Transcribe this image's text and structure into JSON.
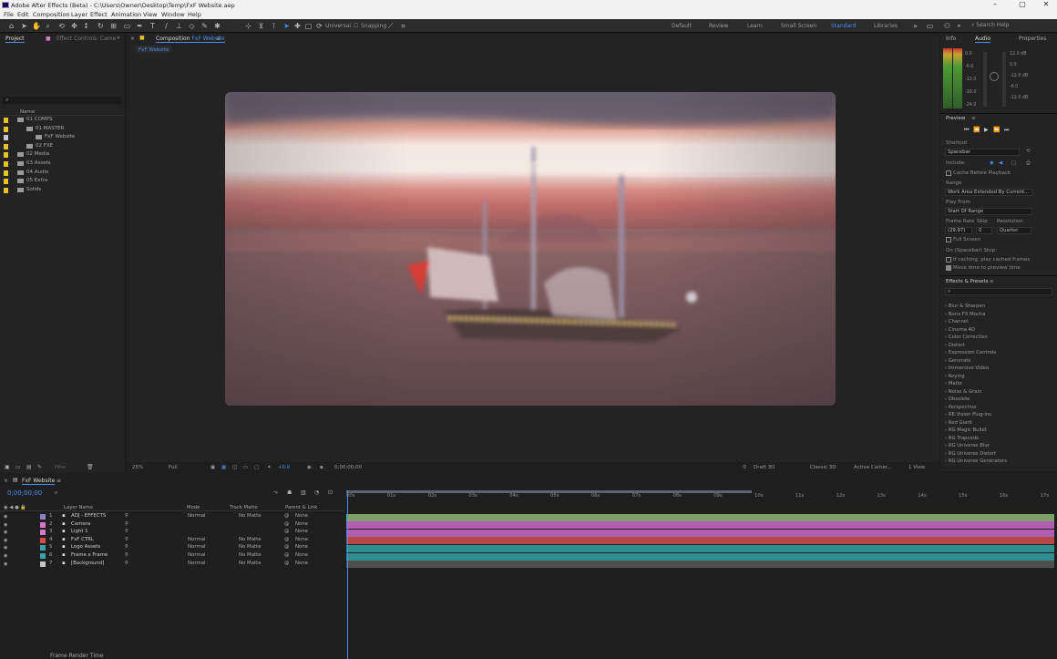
{
  "window": {
    "title": "Adobe After Effects (Beta) - C:\\Users\\Owner\\Desktop\\Temp\\FxF Website.aep"
  },
  "menu": [
    "File",
    "Edit",
    "Composition",
    "Layer",
    "Effect",
    "Animation",
    "View",
    "Window",
    "Help"
  ],
  "toolbar": {
    "universal": "Universal",
    "snapping": "Snapping",
    "workspaces": [
      "Default",
      "Review",
      "Learn",
      "Small Screen",
      "Standard",
      "Libraries"
    ],
    "active_workspace": "Standard",
    "search_placeholder": "Search Help"
  },
  "project": {
    "tabs": [
      "Project",
      "Effect Controls: Came"
    ],
    "col_name": "Name",
    "items": [
      {
        "label": "01 COMPS",
        "color": "#e6c229"
      },
      {
        "label": "01 MASTER",
        "color": "#e6c229"
      },
      {
        "label": "FxF Website",
        "color": "#c6c6c6"
      },
      {
        "label": "02 FXE",
        "color": "#e6c229"
      },
      {
        "label": "02 Media",
        "color": "#e6c229"
      },
      {
        "label": "03 Assets",
        "color": "#e6c229"
      },
      {
        "label": "04 Audio",
        "color": "#e6c229"
      },
      {
        "label": "05 Extra",
        "color": "#e6c229"
      },
      {
        "label": "Solids",
        "color": "#e6c229"
      }
    ]
  },
  "viewer": {
    "tab": "Composition",
    "comp_name": "FxF Website",
    "breadcrumb": "FxF Website",
    "zoom": "25%",
    "resolution": "Full",
    "timecode": "0;00;00;00",
    "renderer": "Draft 3D",
    "renderer_mode": "Classic 3D",
    "camera": "Active Camer...",
    "views": "1 View",
    "exposure": "+0.0"
  },
  "right": {
    "tabs": [
      "Info",
      "Audio",
      "Properties"
    ],
    "audio_db": [
      "0.0",
      "-6.0",
      "-12.0",
      "-18.0",
      "-24.0"
    ],
    "audio_right": [
      "12.0 dB",
      "0.0",
      "-12.0 dB",
      "-6.0",
      "-12.0 dB"
    ],
    "preview": {
      "title": "Preview",
      "shortcut_label": "Shortcut",
      "shortcut": "Spacebar",
      "include_label": "Include:",
      "cache": "Cache Before Playback",
      "range_label": "Range",
      "range": "Work Area Extended By Current...",
      "play_from_label": "Play From",
      "play_from": "Start Of Range",
      "frame_rate_label": "Frame Rate",
      "skip_label": "Skip",
      "resolution_label": "Resolution",
      "frame_rate": "(29.97)",
      "skip": "0",
      "resolution": "Quarter",
      "full_screen": "Full Screen",
      "on_stop": "On (Spacebar) Stop:",
      "if_caching": "If caching, play cached frames",
      "move_time": "Move time to preview time"
    },
    "effects": {
      "title": "Effects & Presets",
      "items": [
        "Blur & Sharpen",
        "Boris FX Mocha",
        "Channel",
        "Cinema 4D",
        "Color Correction",
        "Distort",
        "Expression Controls",
        "Generate",
        "Immersive Video",
        "Keying",
        "Matte",
        "Noise & Grain",
        "Obsolete",
        "Perspective",
        "RE:Vision Plug-ins",
        "Red Giant",
        "RG Magic Bullet",
        "RG Trapcode",
        "RG Universe Blur",
        "RG Universe Distort",
        "RG Universe Generators"
      ]
    }
  },
  "timeline": {
    "tab": "FxF Website",
    "timecode": "0;00;00;00",
    "headers": {
      "layer_name": "Layer Name",
      "mode": "Mode",
      "track_matte": "Track Matte",
      "parent": "Parent & Link"
    },
    "ruler": [
      "00s",
      "01s",
      "02s",
      "03s",
      "04s",
      "05s",
      "06s",
      "07s",
      "08s",
      "09s",
      "10s",
      "11s",
      "12s",
      "13s",
      "14s",
      "15s",
      "16s",
      "17s"
    ],
    "layers": [
      {
        "num": "1",
        "name": "ADJ - EFFECTS",
        "label": "#8f7fc4",
        "mode": "Normal",
        "matte": "No Matte",
        "parent": "None"
      },
      {
        "num": "2",
        "name": "Camera",
        "label": "#d677c9",
        "mode": "",
        "matte": "",
        "parent": "None"
      },
      {
        "num": "3",
        "name": "Light 1",
        "label": "#d677c9",
        "mode": "",
        "matte": "",
        "parent": "None"
      },
      {
        "num": "4",
        "name": "FxF CTRL",
        "label": "#d94b4b",
        "mode": "Normal",
        "matte": "No Matte",
        "parent": "None"
      },
      {
        "num": "5",
        "name": "Logo Assets",
        "label": "#3aa3a7",
        "mode": "Normal",
        "matte": "No Matte",
        "parent": "None"
      },
      {
        "num": "6",
        "name": "Frame x Frame",
        "label": "#3aa3a7",
        "mode": "Normal",
        "matte": "No Matte",
        "parent": "None"
      },
      {
        "num": "7",
        "name": "[Background]",
        "label": "#c6c6c6",
        "mode": "Normal",
        "matte": "No Matte",
        "parent": "None"
      }
    ],
    "bar_colors": [
      "#7c9f6a",
      "#b05fb0",
      "#b05fb0",
      "#b24848",
      "#2f8d92",
      "#2f8d92",
      "#4f4f4f"
    ],
    "footer": "Frame Render Time"
  }
}
